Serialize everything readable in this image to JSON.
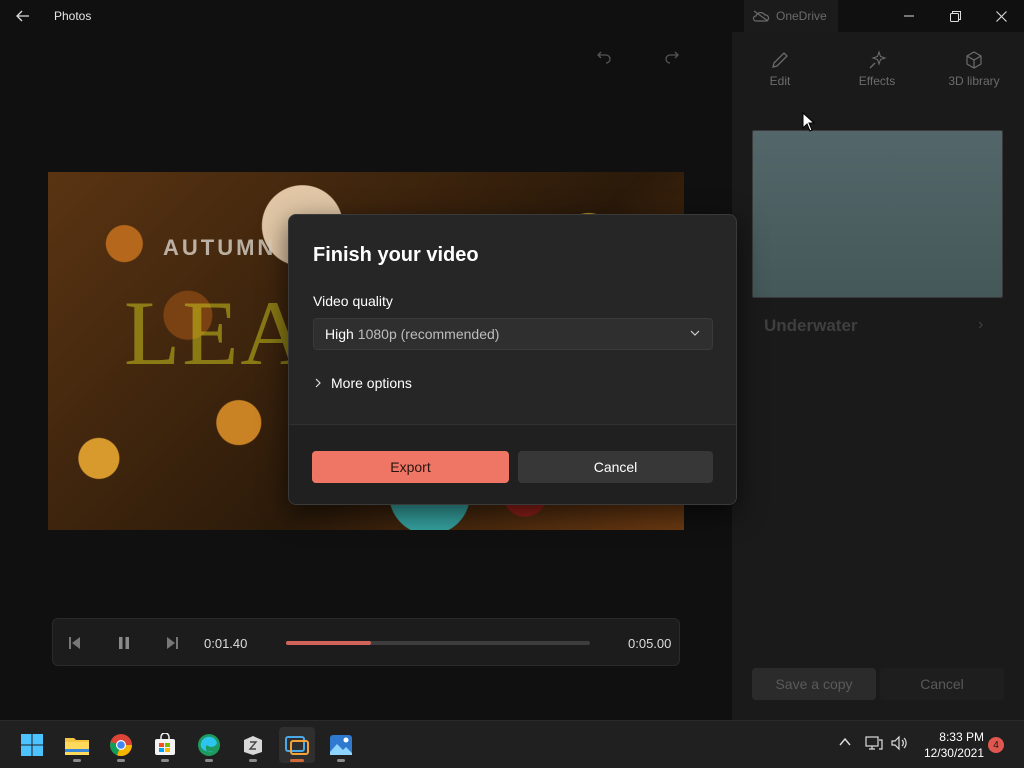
{
  "window": {
    "title": "Photos",
    "onedrive_label": "OneDrive"
  },
  "preview": {
    "caption_top": "AUTUMN",
    "caption_large": "LEAVE"
  },
  "player": {
    "current_time": "0:01.40",
    "total_time": "0:05.00",
    "progress": 0.28
  },
  "right_panel": {
    "tabs": [
      {
        "label": "Edit",
        "icon": "pencil-icon"
      },
      {
        "label": "Effects",
        "icon": "sparkle-icon"
      },
      {
        "label": "3D library",
        "icon": "cube-icon"
      }
    ],
    "effect_name": "Underwater",
    "save_copy_label": "Save a copy",
    "cancel_label": "Cancel"
  },
  "dialog": {
    "title": "Finish your video",
    "quality_label": "Video quality",
    "quality_value_main": "High",
    "quality_value_detail": "1080p (recommended)",
    "more_options_label": "More options",
    "export_label": "Export",
    "cancel_label": "Cancel",
    "accent_color": "#ef7665"
  },
  "taskbar": {
    "apps": [
      "start-icon",
      "file-explorer-icon",
      "chrome-icon",
      "store-icon",
      "edge-icon",
      "mail-icon",
      "video-editor-icon",
      "photos-icon"
    ],
    "time": "8:33 PM",
    "date": "12/30/2021",
    "notification_count": "4"
  }
}
